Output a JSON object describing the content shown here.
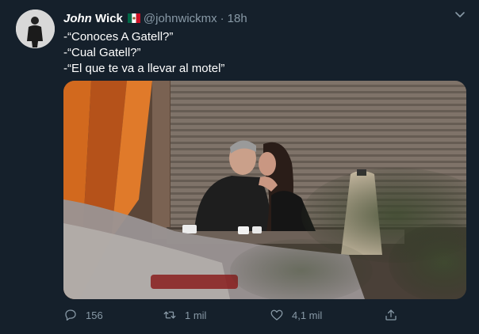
{
  "author": {
    "name_first": "John",
    "name_last": "Wick",
    "handle": "@johnwickmx",
    "separator": "·",
    "timestamp": "18h",
    "flag_icon": "mexico-flag-icon"
  },
  "tweet": {
    "lines": [
      "-“Conoces A Gatell?”",
      "-“Cual Gatell?”",
      "-“El que te va a llevar al motel”"
    ]
  },
  "actions": {
    "reply_count": "156",
    "retweet_count": "1 mil",
    "like_count": "4,1 mil",
    "reply_icon": "reply-icon",
    "retweet_icon": "retweet-icon",
    "like_icon": "heart-icon",
    "share_icon": "share-icon"
  },
  "colors": {
    "background": "#15202b",
    "secondary_text": "#8899a6",
    "primary_text": "#ffffff"
  }
}
